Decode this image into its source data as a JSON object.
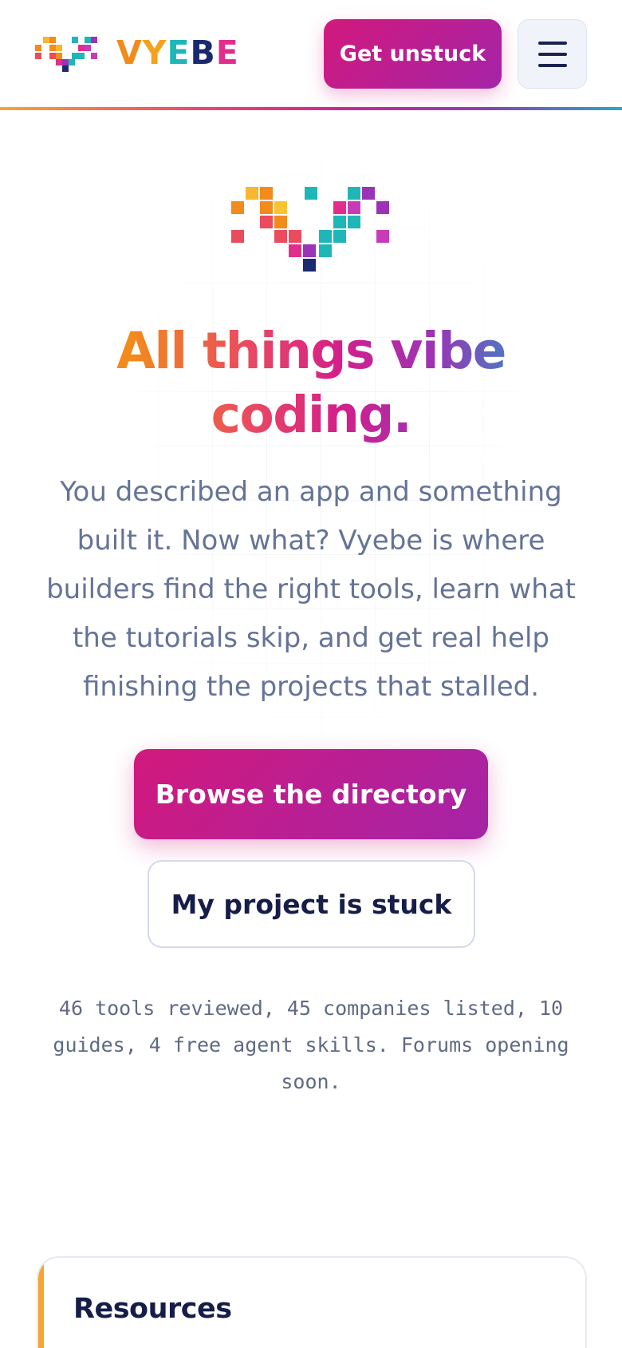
{
  "header": {
    "brand_name": "VYEBE",
    "brand_letter_colors": [
      "#f28a1c",
      "#f2a21c",
      "#1fb6b8",
      "#1a2a6e",
      "#e22d8f"
    ],
    "cta_label": "Get unstuck",
    "menu_icon": "hamburger-icon"
  },
  "hero": {
    "logo_icon": "pixel-heart-icon",
    "headline": "All things vibe coding.",
    "lead": "You described an app and something built it. Now what? Vyebe is where builders find the right tools, learn what the tutorials skip, and get real help finishing the projects that stalled.",
    "primary_button": "Browse the directory",
    "secondary_button": "My project is stuck",
    "stats": "46 tools reviewed, 45 companies listed, 10 guides, 4 free agent skills. Forums opening soon."
  },
  "resources": {
    "title": "Resources"
  },
  "colors": {
    "accent_pink": "#d2197c",
    "accent_purple": "#a424a8",
    "navy": "#161d48",
    "muted_text": "#657396",
    "accent_orange": "#f7a531"
  }
}
